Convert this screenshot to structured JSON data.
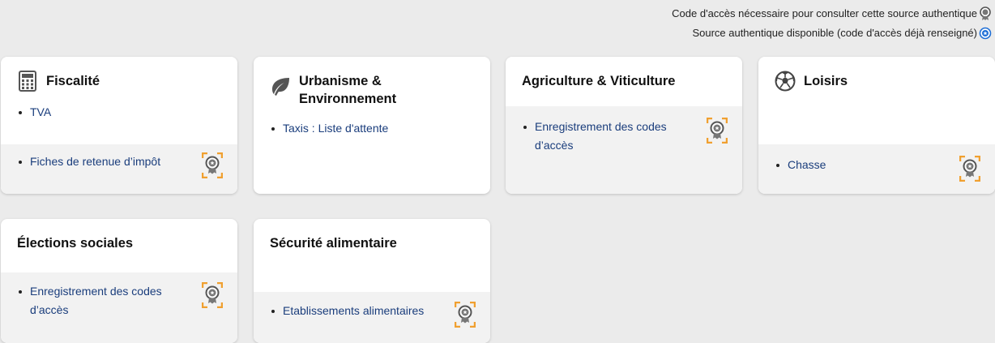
{
  "legend": {
    "required_label": "Code d'accès nécessaire pour consulter cette source authentique",
    "available_label": "Source authentique disponible (code d'accès déjà renseigné)"
  },
  "colors": {
    "accent_orange": "#f0a030",
    "link_blue": "#1a3d7c",
    "available_blue": "#1f6fd6"
  },
  "cards": [
    {
      "title": "Fiscalité",
      "icon": "calculator-icon",
      "free_links": [
        "TVA"
      ],
      "auth_links": [
        "Fiches de retenue d’impôt"
      ]
    },
    {
      "title": "Urbanisme & Environnement",
      "icon": "leaf-icon",
      "free_links": [
        "Taxis : Liste d'attente"
      ],
      "auth_links": []
    },
    {
      "title": "Agriculture & Viticulture",
      "icon": "",
      "free_links": [],
      "auth_links": [
        "Enregistrement des codes d’accès"
      ]
    },
    {
      "title": "Loisirs",
      "icon": "soccer-ball-icon",
      "free_links": [],
      "auth_links": [
        "Chasse"
      ]
    },
    {
      "title": "Élections sociales",
      "icon": "",
      "free_links": [],
      "auth_links": [
        "Enregistrement des codes d’accès"
      ]
    },
    {
      "title": "Sécurité alimentaire",
      "icon": "",
      "free_links": [],
      "auth_links": [
        "Etablissements alimentaires"
      ]
    }
  ]
}
